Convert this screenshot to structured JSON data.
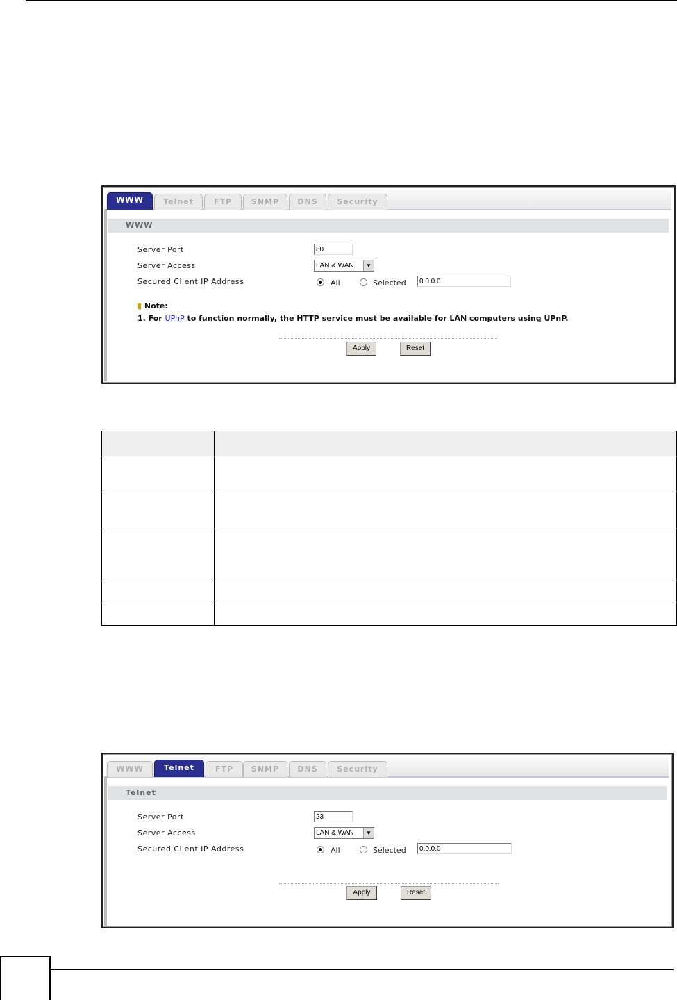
{
  "tabs": [
    "WWW",
    "Telnet",
    "FTP",
    "SNMP",
    "DNS",
    "Security"
  ],
  "panel_www": {
    "active_tab": 0,
    "section_title": "WWW",
    "fields": {
      "server_port_label": "Server Port",
      "server_port_value": "80",
      "server_access_label": "Server Access",
      "server_access_value": "LAN & WAN",
      "secured_ip_label": "Secured Client IP Address",
      "radio_all": "All",
      "radio_selected": "Selected",
      "ip_value": "0.0.0.0"
    },
    "note_title": "Note:",
    "note_prefix": "1. For ",
    "note_link": "UPnP",
    "note_suffix": " to function normally, the HTTP service must be available for LAN computers using UPnP.",
    "apply": "Apply",
    "reset": "Reset"
  },
  "panel_telnet": {
    "active_tab": 1,
    "section_title": "Telnet",
    "fields": {
      "server_port_label": "Server Port",
      "server_port_value": "23",
      "server_access_label": "Server Access",
      "server_access_value": "LAN & WAN",
      "secured_ip_label": "Secured Client IP Address",
      "radio_all": "All",
      "radio_selected": "Selected",
      "ip_value": "0.0.0.0"
    },
    "apply": "Apply",
    "reset": "Reset"
  }
}
